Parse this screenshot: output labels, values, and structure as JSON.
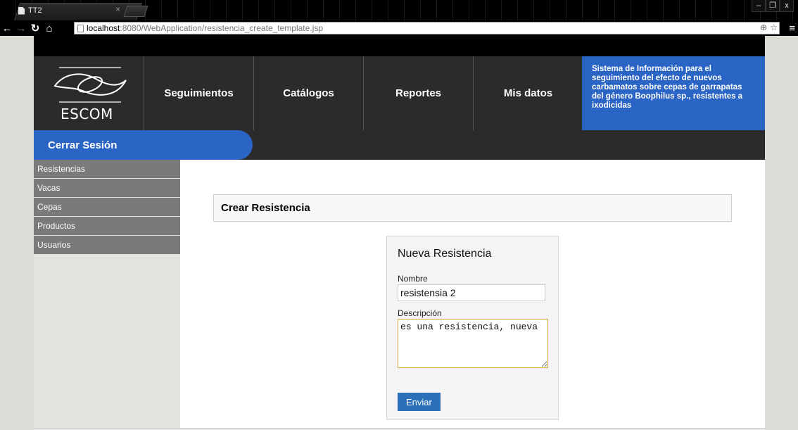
{
  "browser": {
    "tab_title": "TT2",
    "tab_close": "×",
    "url_host": "localhost",
    "url_rest": ":8080/WebApplication/resistencia_create_template.jsp",
    "window_controls": [
      "–",
      "❐",
      "x"
    ],
    "menu_glyph": "≡",
    "zoom_glyph": "⊕",
    "star_glyph": "☆"
  },
  "header": {
    "logo_text": "ESCOM",
    "nav": [
      "Seguimientos",
      "Catálogos",
      "Reportes",
      "Mis datos"
    ],
    "system_info": "Sistema de Información para el seguimiento del efecto de nuevos carbamatos sobre cepas de garrapatas del género Boophilus sp., resistentes a ixodicidas"
  },
  "subbar": {
    "logout_label": "Cerrar Sesión"
  },
  "sidebar": {
    "items": [
      "Resistencias",
      "Vacas",
      "Cepas",
      "Productos",
      "Usuarios"
    ]
  },
  "main": {
    "heading": "Crear Resistencia",
    "form": {
      "title": "Nueva Resistencia",
      "name_label": "Nombre",
      "name_value": "resistensia 2",
      "description_label": "Descripción",
      "description_value": "es una resistencia, nueva",
      "submit_label": "Enviar"
    }
  },
  "colors": {
    "accent": "#2a64c5",
    "dark": "#2b2b2b",
    "sidebar_item": "#7a7a7a",
    "focus_border": "#e2a93a"
  }
}
